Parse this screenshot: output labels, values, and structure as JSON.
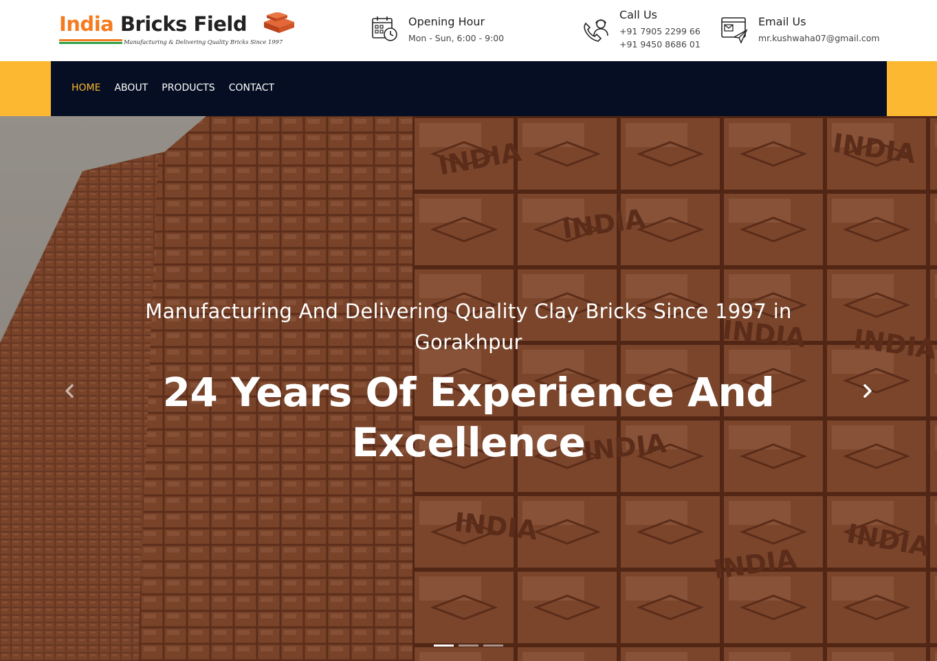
{
  "brand": {
    "name_part1": "India",
    "name_part2": "Bricks Field",
    "tagline": "Manufacturing & Delivering Quality Bricks Since 1997"
  },
  "header_info": {
    "hours": {
      "title": "Opening Hour",
      "value": "Mon - Sun, 6:00 - 9:00",
      "icon": "calendar-clock-icon"
    },
    "call": {
      "title": "Call Us",
      "phone1": "+91 7905 2299 66",
      "phone2": "+91 9450 8686 01",
      "icon": "phone-support-icon"
    },
    "email": {
      "title": "Email Us",
      "value": "mr.kushwaha07@gmail.com",
      "icon": "email-send-icon"
    }
  },
  "nav": {
    "items": [
      {
        "label": "HOME",
        "active": true
      },
      {
        "label": "ABOUT",
        "active": false
      },
      {
        "label": "PRODUCTS",
        "active": false
      },
      {
        "label": "CONTACT",
        "active": false
      }
    ]
  },
  "hero": {
    "subtitle": "Manufacturing And Delivering Quality Clay Bricks Since 1997 in Gorakhpur",
    "title": "24 Years Of Experience And Excellence",
    "brick_stamp": "INDIA",
    "slides_count": 3,
    "active_slide": 0
  },
  "colors": {
    "accent": "#fcb831",
    "nav_bg": "#050e22",
    "brand_orange": "#f47b20",
    "brand_green": "#2ea043",
    "brick": "#a8603c"
  }
}
